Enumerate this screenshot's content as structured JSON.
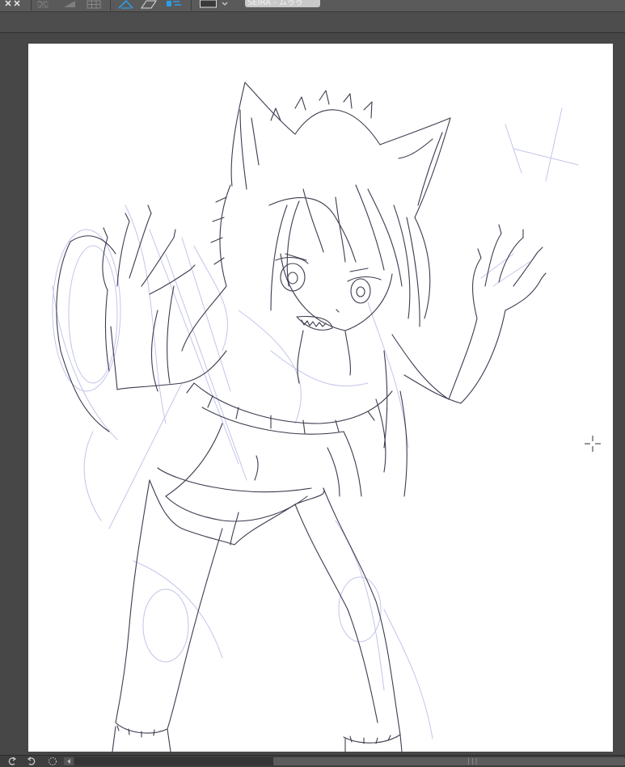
{
  "toolbar": {
    "subview_dropdown": {
      "value": "SEIRA - ムゥゥ"
    },
    "colors": {
      "accent": "#2e9ce6",
      "background": "#5a5a5a"
    }
  },
  "canvas": {
    "paper_color": "#ffffff",
    "sketch_color": "#3c3c50",
    "rough_color": "#b8bbe6"
  },
  "statusbar": {
    "scroll_grip": "|||"
  }
}
